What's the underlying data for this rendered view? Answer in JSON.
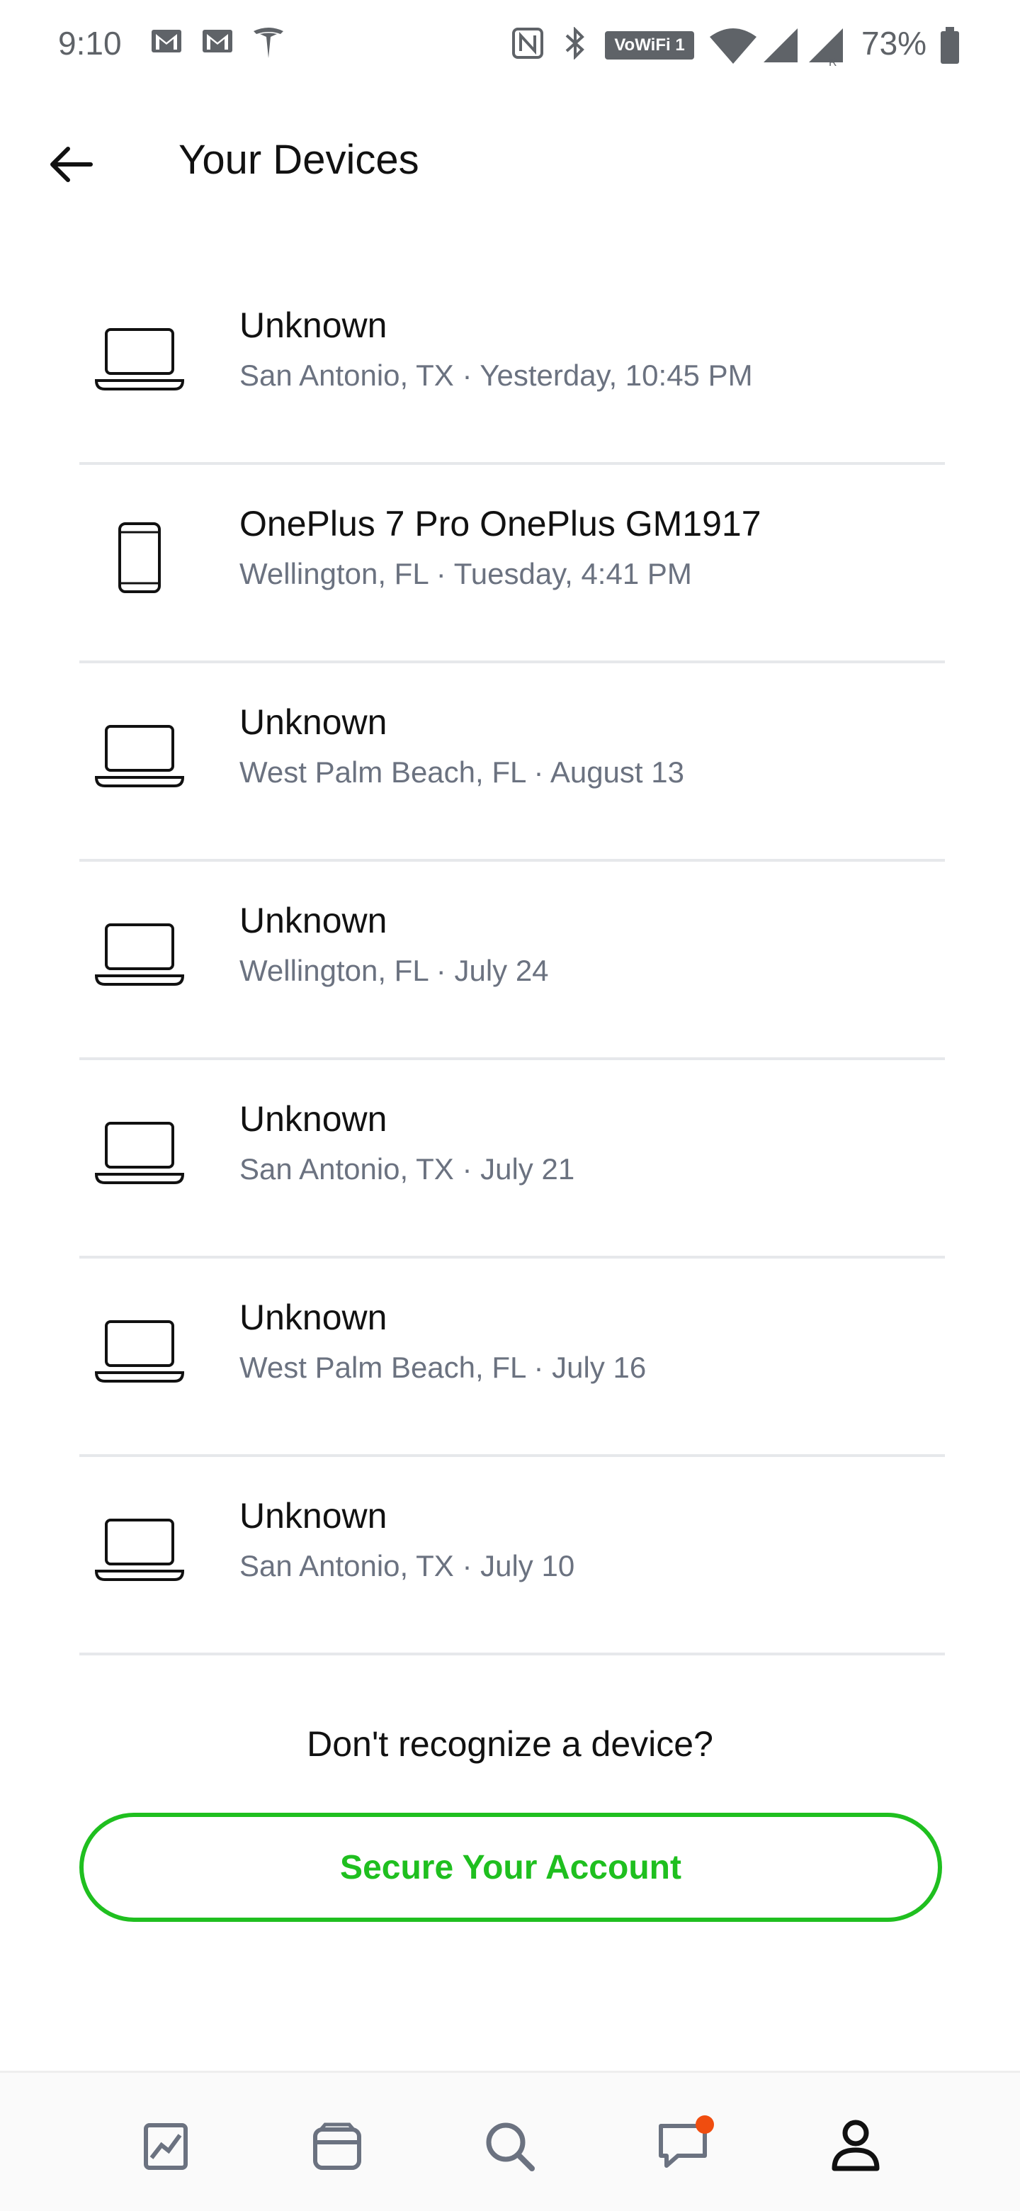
{
  "status_bar": {
    "time": "9:10",
    "wifi_label": "VoWiFi 1",
    "battery_percent": "73%",
    "notification_icons": [
      "gmail-icon",
      "gmail-icon",
      "tesla-icon"
    ],
    "system_icons": [
      "nfc-icon",
      "bluetooth-icon",
      "vowifi-icon",
      "wifi-icon",
      "signal-icon",
      "signal-roaming-icon",
      "battery-icon"
    ]
  },
  "header": {
    "title": "Your Devices",
    "back_icon": "arrow-left-icon"
  },
  "devices": [
    {
      "name": "Unknown",
      "meta": "San Antonio, TX · Yesterday, 10:45 PM",
      "icon": "laptop-icon"
    },
    {
      "name": "OnePlus 7 Pro OnePlus GM1917",
      "meta": "Wellington, FL · Tuesday, 4:41 PM",
      "icon": "phone-icon"
    },
    {
      "name": "Unknown",
      "meta": "West Palm Beach, FL · August 13",
      "icon": "laptop-icon"
    },
    {
      "name": "Unknown",
      "meta": "Wellington, FL · July 24",
      "icon": "laptop-icon"
    },
    {
      "name": "Unknown",
      "meta": "San Antonio, TX · July 21",
      "icon": "laptop-icon"
    },
    {
      "name": "Unknown",
      "meta": "West Palm Beach, FL · July 16",
      "icon": "laptop-icon"
    },
    {
      "name": "Unknown",
      "meta": "San Antonio, TX · July 10",
      "icon": "laptop-icon"
    }
  ],
  "footer": {
    "prompt": "Don't recognize a device?",
    "secure_button_label": "Secure Your Account"
  },
  "bottom_nav": {
    "items": [
      "activity-chart-icon",
      "wallet-icon",
      "search-icon",
      "messages-icon",
      "profile-icon"
    ],
    "active": "profile-icon",
    "has_message_notification": true
  },
  "colors": {
    "accent_green": "#1fbf1f",
    "notification_dot": "#f04d0f",
    "secondary_text": "#6b7280",
    "divider": "#e6e8eb"
  }
}
